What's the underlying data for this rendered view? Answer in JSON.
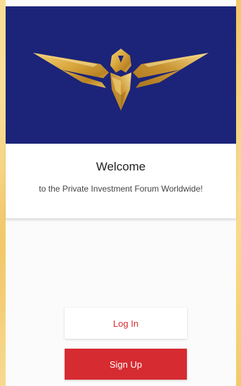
{
  "logo": {
    "icon": "eagle-logo-icon",
    "color": "#d6a53a"
  },
  "welcome": {
    "title": "Welcome",
    "subtitle": "to the Private Investment Forum Worldwide!"
  },
  "actions": {
    "login_label": "Log In",
    "signup_label": "Sign Up"
  },
  "colors": {
    "hero_background": "#1b2479",
    "accent_red": "#d62b31",
    "page_background": "#fbfbfb"
  }
}
